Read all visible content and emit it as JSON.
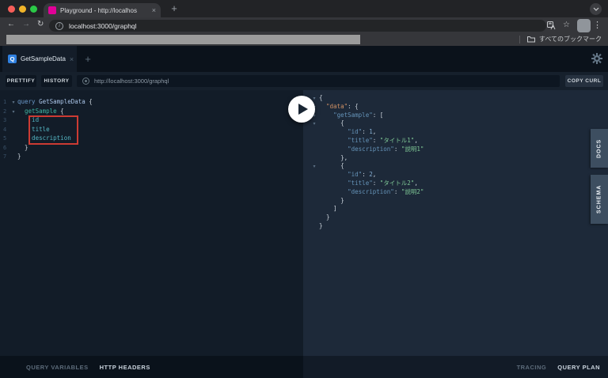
{
  "browser": {
    "tab": {
      "title": "Playground - http://localhos",
      "close_icon": "×"
    },
    "new_tab_icon": "+",
    "nav": {
      "back_icon": "←",
      "forward_icon": "→",
      "reload_icon": "↻",
      "info_icon": "i"
    },
    "url": "localhost:3000/graphql",
    "icons": {
      "star": "☆",
      "kebab": "⋮"
    },
    "bookmarks_bar": {
      "all_bookmarks_label": "すべてのブックマーク"
    }
  },
  "playground": {
    "session_tab": {
      "badge": "Q",
      "label": "GetSampleData",
      "close_icon": "×"
    },
    "new_session_icon": "+",
    "toolbar": {
      "prettify": "PRETTIFY",
      "history": "HISTORY",
      "endpoint": "http://localhost:3000/graphql",
      "copy_curl": "COPY CURL"
    },
    "editor": {
      "lines": [
        {
          "fold": true,
          "seg": [
            [
              "query",
              "kw"
            ],
            [
              " ",
              "pun"
            ],
            [
              "GetSampleData",
              "op"
            ],
            [
              " {",
              "pun"
            ]
          ]
        },
        {
          "fold": true,
          "seg": [
            [
              "  ",
              "pun"
            ],
            [
              "getSample",
              "field"
            ],
            [
              " {",
              "pun"
            ]
          ]
        },
        {
          "fold": false,
          "seg": [
            [
              "    id",
              "prop"
            ]
          ]
        },
        {
          "fold": false,
          "seg": [
            [
              "    title",
              "prop"
            ]
          ]
        },
        {
          "fold": false,
          "seg": [
            [
              "    description",
              "prop"
            ]
          ]
        },
        {
          "fold": false,
          "seg": [
            [
              "  }",
              "pun"
            ]
          ]
        },
        {
          "fold": false,
          "seg": [
            [
              "}",
              "pun"
            ]
          ]
        }
      ]
    },
    "results": {
      "lines": [
        {
          "fold": true,
          "seg": [
            [
              "{",
              "pun"
            ]
          ]
        },
        {
          "fold": true,
          "seg": [
            [
              "  ",
              "pun"
            ],
            [
              "\"data\"",
              "keyd"
            ],
            [
              ": {",
              "pun"
            ]
          ]
        },
        {
          "fold": true,
          "seg": [
            [
              "    ",
              "pun"
            ],
            [
              "\"getSample\"",
              "key"
            ],
            [
              ": [",
              "pun"
            ]
          ]
        },
        {
          "fold": true,
          "seg": [
            [
              "      {",
              "pun"
            ]
          ]
        },
        {
          "fold": false,
          "seg": [
            [
              "        ",
              "pun"
            ],
            [
              "\"id\"",
              "key"
            ],
            [
              ": ",
              "pun"
            ],
            [
              "1",
              "num"
            ],
            [
              ",",
              "pun"
            ]
          ]
        },
        {
          "fold": false,
          "seg": [
            [
              "        ",
              "pun"
            ],
            [
              "\"title\"",
              "key"
            ],
            [
              ": ",
              "pun"
            ],
            [
              "\"タイトル1\"",
              "str"
            ],
            [
              ",",
              "pun"
            ]
          ]
        },
        {
          "fold": false,
          "seg": [
            [
              "        ",
              "pun"
            ],
            [
              "\"description\"",
              "key"
            ],
            [
              ": ",
              "pun"
            ],
            [
              "\"説明1\"",
              "str"
            ]
          ]
        },
        {
          "fold": false,
          "seg": [
            [
              "      },",
              "pun"
            ]
          ]
        },
        {
          "fold": true,
          "seg": [
            [
              "      {",
              "pun"
            ]
          ]
        },
        {
          "fold": false,
          "seg": [
            [
              "        ",
              "pun"
            ],
            [
              "\"id\"",
              "key"
            ],
            [
              ": ",
              "pun"
            ],
            [
              "2",
              "num"
            ],
            [
              ",",
              "pun"
            ]
          ]
        },
        {
          "fold": false,
          "seg": [
            [
              "        ",
              "pun"
            ],
            [
              "\"title\"",
              "key"
            ],
            [
              ": ",
              "pun"
            ],
            [
              "\"タイトル2\"",
              "str"
            ],
            [
              ",",
              "pun"
            ]
          ]
        },
        {
          "fold": false,
          "seg": [
            [
              "        ",
              "pun"
            ],
            [
              "\"description\"",
              "key"
            ],
            [
              ": ",
              "pun"
            ],
            [
              "\"説明2\"",
              "str"
            ]
          ]
        },
        {
          "fold": false,
          "seg": [
            [
              "      }",
              "pun"
            ]
          ]
        },
        {
          "fold": false,
          "seg": [
            [
              "    ]",
              "pun"
            ]
          ]
        },
        {
          "fold": false,
          "seg": [
            [
              "  }",
              "pun"
            ]
          ]
        },
        {
          "fold": false,
          "seg": [
            [
              "}",
              "pun"
            ]
          ]
        }
      ]
    },
    "sidebar": {
      "docs": "DOCS",
      "schema": "SCHEMA"
    },
    "footer": {
      "query_variables": "QUERY VARIABLES",
      "http_headers": "HTTP HEADERS",
      "tracing": "TRACING",
      "query_plan": "QUERY PLAN"
    }
  },
  "colors": {
    "playground_pink": "#e10098",
    "badge_blue": "#2f80e0",
    "annotation_red": "#cc3b33",
    "string_green": "#7ec795",
    "key_blue": "#6593b8",
    "data_key_orange": "#cf9064"
  }
}
